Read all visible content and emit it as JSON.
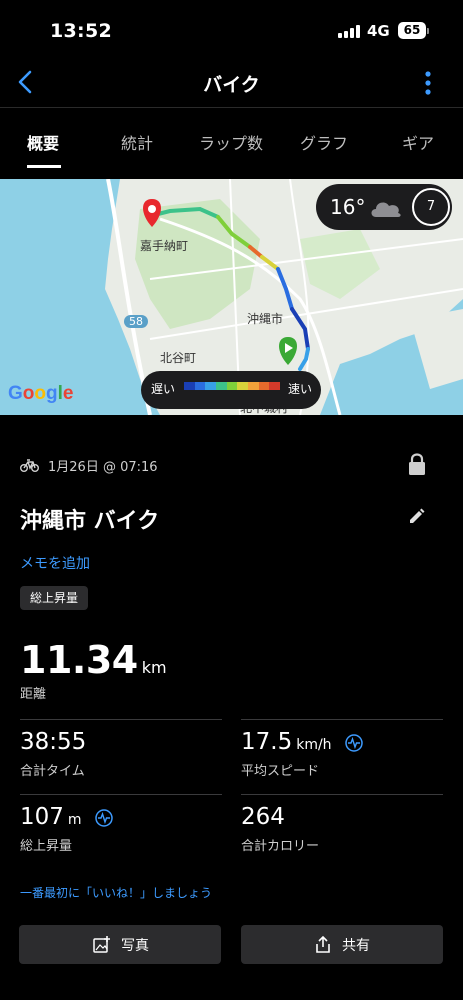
{
  "status_bar": {
    "time": "13:52",
    "network": "4G",
    "battery": "65"
  },
  "header": {
    "title": "バイク",
    "back_icon": "chevron-left-icon",
    "menu_icon": "more-vertical-icon"
  },
  "tabs": [
    {
      "label": "概要",
      "active": true
    },
    {
      "label": "統計",
      "active": false
    },
    {
      "label": "ラップ数",
      "active": false
    },
    {
      "label": "グラフ",
      "active": false
    },
    {
      "label": "ギア",
      "active": false
    }
  ],
  "map": {
    "labels": {
      "town1": "嘉手納町",
      "city": "沖縄市",
      "town2": "北谷町",
      "route": "58",
      "town3": "北中城村"
    },
    "weather": {
      "temperature": "16°",
      "icon": "cloud-icon",
      "wind": "7"
    },
    "legend": {
      "slow": "遅い",
      "fast": "速い",
      "colors": [
        "#1a3fb5",
        "#2a6de0",
        "#37a0e8",
        "#3cc28a",
        "#7fcf3a",
        "#d8d23a",
        "#f2a23a",
        "#e66a2c",
        "#d43a2a"
      ]
    },
    "attribution": "Google"
  },
  "activity": {
    "date": "1月26日 @ 07:16",
    "name": "沖縄市 バイク",
    "add_memo": "メモを追加",
    "tag": "総上昇量"
  },
  "stats": {
    "distance": {
      "value": "11.34",
      "unit": "km",
      "label": "距離"
    },
    "time": {
      "value": "38:55",
      "unit": "",
      "label": "合計タイム"
    },
    "avg_speed": {
      "value": "17.5",
      "unit": "km/h",
      "label": "平均スピード"
    },
    "ascent": {
      "value": "107",
      "unit": "m",
      "label": "総上昇量"
    },
    "calories": {
      "value": "264",
      "unit": "",
      "label": "合計カロリー"
    }
  },
  "social": {
    "like_prompt": "一番最初に「いいね！」しましょう"
  },
  "actions": {
    "photo": "写真",
    "share": "共有"
  },
  "colors": {
    "accent": "#3d9bff",
    "background": "#000000",
    "card": "#2c2c2e",
    "start_marker": "#3aa935",
    "end_marker": "#e8282d"
  }
}
